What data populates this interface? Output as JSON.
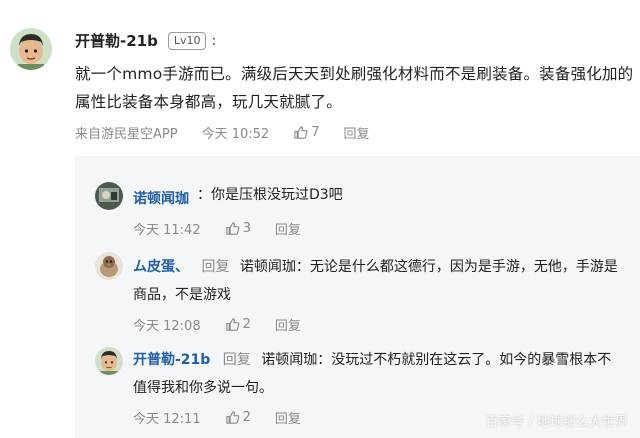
{
  "colors": {
    "link_blue": "#1f5fa8",
    "meta_gray": "#8a8a8a",
    "reply_bg": "#f5f6f7"
  },
  "post": {
    "username": "开普勒-21b",
    "level": "Lv10",
    "colon": ":",
    "text": "就一个mmo手游而已。满级后天天到处刷强化材料而不是刷装备。装备强化加的属性比装备本身都高，玩几天就腻了。",
    "source": "来自游民星空APP",
    "time": "今天 10:52",
    "likes": "7",
    "reply_label": "回复",
    "avatar_icon": "cartoon-avatar-icon"
  },
  "replies": [
    {
      "username": "诺顿闻珈",
      "colon": "：",
      "text": "你是压根没玩过D3吧",
      "time": "今天 11:42",
      "likes": "3",
      "reply_label": "回复",
      "avatar_icon": "photo-avatar-icon"
    },
    {
      "username": "ム皮蛋、",
      "reply_word": "回复",
      "target": "诺顿闻珈",
      "colon": "：",
      "text": "无论是什么都这德行，因为是手游，无他，手游是商品，不是游戏",
      "time": "今天 12:08",
      "likes": "2",
      "reply_label": "回复",
      "avatar_icon": "bird-avatar-icon"
    },
    {
      "username": "开普勒-21b",
      "reply_word": "回复",
      "target": "诺顿闻珈",
      "colon": "：",
      "text": "没玩过不朽就别在这云了。如今的暴雪根本不值得我和你多说一句。",
      "time": "今天 12:11",
      "likes": "2",
      "reply_label": "回复",
      "avatar_icon": "cartoon-avatar-icon"
    }
  ],
  "watermark": "百家号 / 地球那么大世界"
}
